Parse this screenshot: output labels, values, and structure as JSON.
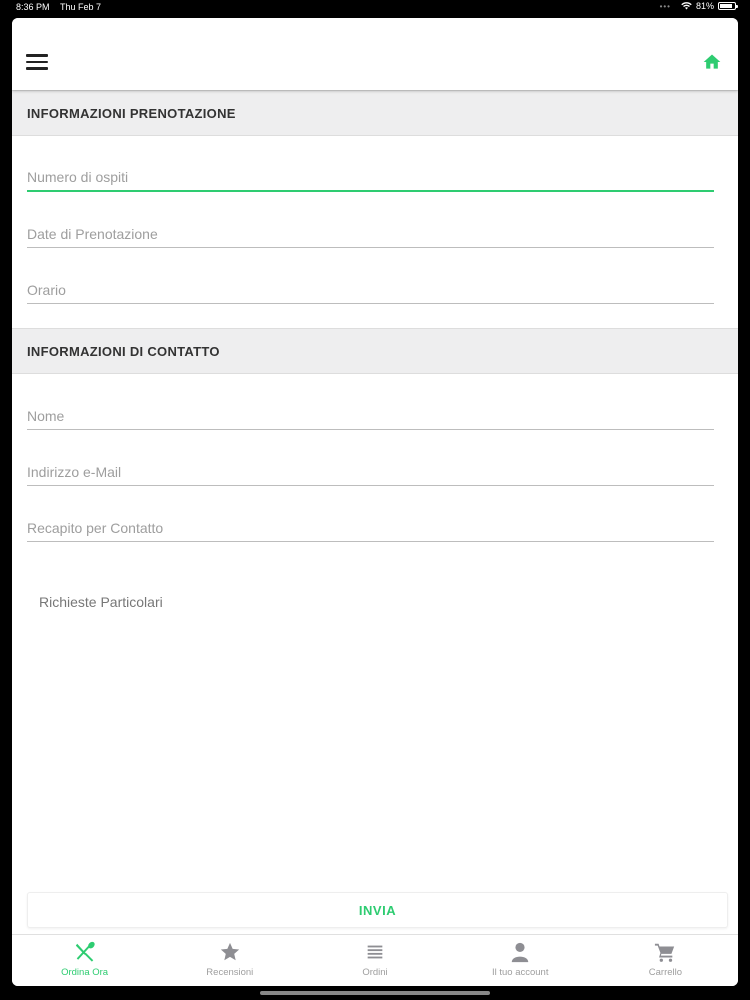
{
  "status_bar": {
    "time": "8:36 PM",
    "date": "Thu Feb 7",
    "battery": "81%"
  },
  "reservation_section": {
    "title": "INFORMAZIONI PRENOTAZIONE"
  },
  "reservation_fields": {
    "guests_placeholder": "Numero di ospiti",
    "date_placeholder": "Date di Prenotazione",
    "time_placeholder": "Orario"
  },
  "contact_section": {
    "title": "INFORMAZIONI DI CONTATTO"
  },
  "contact_fields": {
    "name_placeholder": "Nome",
    "email_placeholder": "Indirizzo e-Mail",
    "phone_placeholder": "Recapito per Contatto",
    "requests_placeholder": "Richieste Particolari"
  },
  "submit_label": "INVIA",
  "tabs": [
    {
      "label": "Ordina Ora",
      "icon": "utensils-icon",
      "active": true
    },
    {
      "label": "Recensioni",
      "icon": "star-icon",
      "active": false
    },
    {
      "label": "Ordini",
      "icon": "list-icon",
      "active": false
    },
    {
      "label": "Il tuo account",
      "icon": "person-icon",
      "active": false
    },
    {
      "label": "Carrello",
      "icon": "cart-icon",
      "active": false
    }
  ],
  "colors": {
    "accent": "#2ecc71",
    "header_bg": "#eeeeef",
    "icon_gray": "#8e8e93"
  }
}
